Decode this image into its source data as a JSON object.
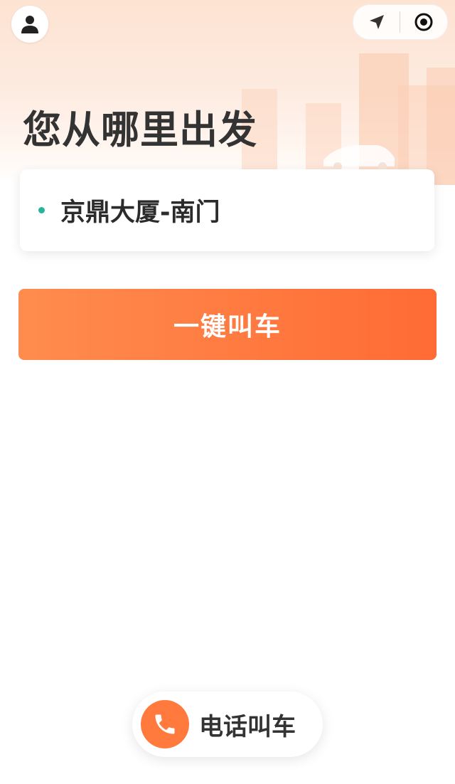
{
  "header": {
    "title": "您从哪里出发"
  },
  "top_bar": {
    "profile_icon": "user-icon",
    "capsule_icons": [
      "navigation-arrow-icon",
      "target-circle-icon"
    ]
  },
  "location": {
    "name": "京鼎大厦-南门",
    "dot_color": "#26b59a"
  },
  "actions": {
    "one_click_label": "一键叫车",
    "phone_call_label": "电话叫车"
  },
  "colors": {
    "accent": "#ff7a3c",
    "header_tint": "#fde3d2"
  }
}
